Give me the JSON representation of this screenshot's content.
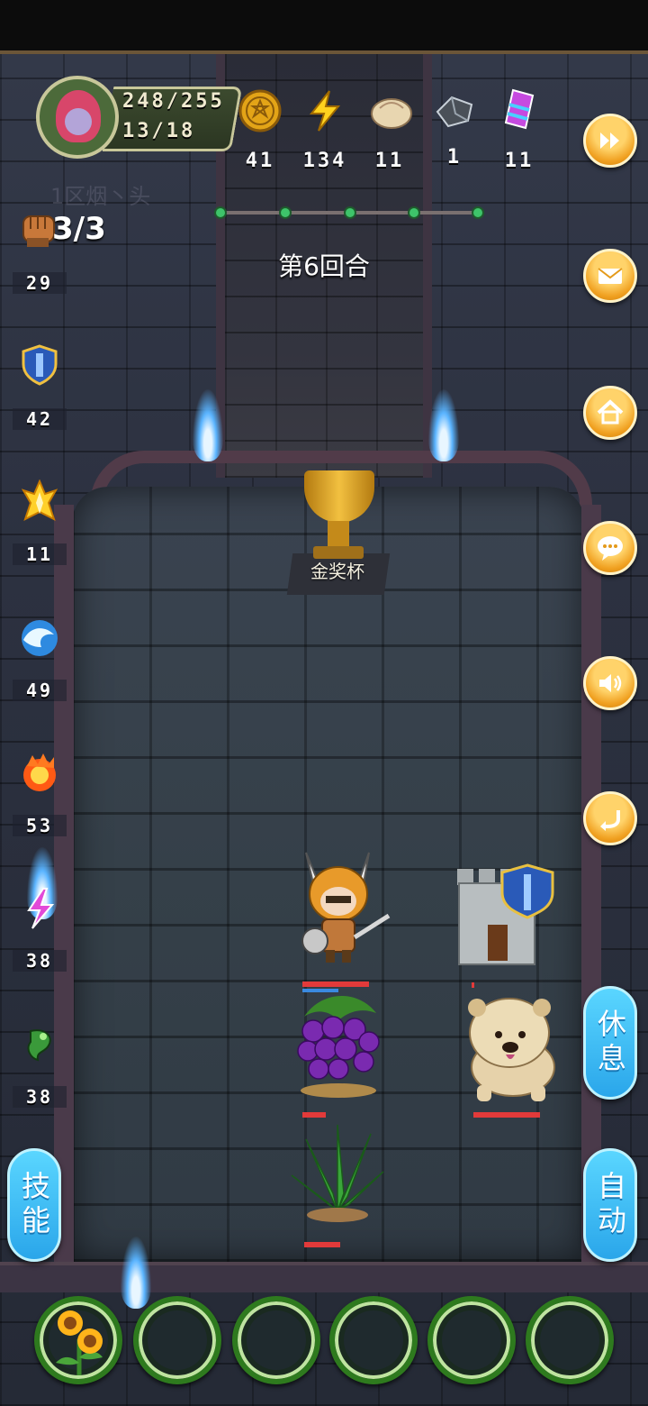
{
  "player": {
    "hp": "248/255",
    "level": "13/18",
    "faded_name": "1区烟丶头"
  },
  "resources": [
    {
      "icon": "gold-coin-icon",
      "value": "41"
    },
    {
      "icon": "lightning-energy-icon",
      "value": "134"
    },
    {
      "icon": "dumpling-icon",
      "value": "11"
    },
    {
      "icon": "iron-ore-icon",
      "value": "1"
    },
    {
      "icon": "crystal-gem-icon",
      "value": "11"
    }
  ],
  "attack_count": "3/3",
  "round_label": "第6回合",
  "round_progress_dots": 5,
  "side_stats": [
    {
      "icon": "fist-icon",
      "value": "29"
    },
    {
      "icon": "shield-icon",
      "value": "42"
    },
    {
      "icon": "holy-light-icon",
      "value": "11"
    },
    {
      "icon": "water-wave-icon",
      "value": "49"
    },
    {
      "icon": "fire-icon",
      "value": "53"
    },
    {
      "icon": "lightning-bolt-icon",
      "value": "38"
    },
    {
      "icon": "poison-icon",
      "value": "38"
    }
  ],
  "right_buttons": [
    "fast-forward-icon",
    "mail-icon",
    "home-icon",
    "chat-icon",
    "sound-icon",
    "return-icon"
  ],
  "trophy_label": "金奖杯",
  "buttons": {
    "skill": "技能",
    "rest": "休息",
    "auto": "自动"
  },
  "units": [
    {
      "name": "hero-knight",
      "hp_fraction": 0.9
    },
    {
      "name": "grapes",
      "hp_fraction": 0.3
    },
    {
      "name": "grass-bush",
      "hp_fraction": 0.5
    },
    {
      "name": "shield-tower",
      "hp_fraction": 0.0
    },
    {
      "name": "chow-dog",
      "hp_fraction": 0.9
    }
  ],
  "slots": [
    "sunflower",
    "empty",
    "empty",
    "empty",
    "empty",
    "empty"
  ],
  "colors": {
    "hp_red": "#e23a3a",
    "accent_orange": "#f0a020",
    "accent_blue": "#2aa6ea"
  }
}
